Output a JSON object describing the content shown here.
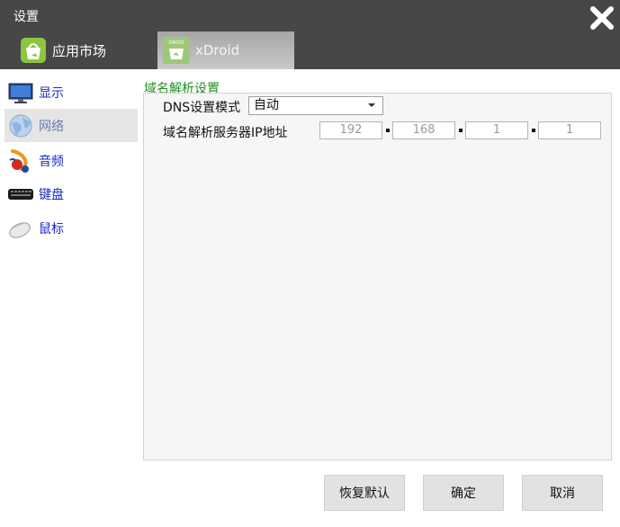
{
  "window": {
    "title": "设置"
  },
  "tabs": [
    {
      "label": "应用市场",
      "icon": "android-market-icon"
    },
    {
      "label": "xDroid",
      "icon": "xdroid-icon",
      "icon_text": "DROID"
    }
  ],
  "sidebar": {
    "items": [
      {
        "label": "显示",
        "icon": "monitor-icon"
      },
      {
        "label": "网络",
        "icon": "globe-icon",
        "active": true
      },
      {
        "label": "音频",
        "icon": "audio-icon"
      },
      {
        "label": "键盘",
        "icon": "keyboard-icon"
      },
      {
        "label": "鼠标",
        "icon": "mouse-icon"
      }
    ]
  },
  "dns": {
    "group_title": "域名解析设置",
    "mode_label": "DNS设置模式",
    "mode_value": "自动",
    "server_label": "域名解析服务器IP地址",
    "ip": [
      "192",
      "168",
      "1",
      "1"
    ]
  },
  "buttons": {
    "restore_default": "恢复默认",
    "ok": "确定",
    "cancel": "取消"
  },
  "colors": {
    "titlebar": "#474747",
    "group_title": "#1d8f1d",
    "sidebar_text": "#1a2ac0"
  }
}
